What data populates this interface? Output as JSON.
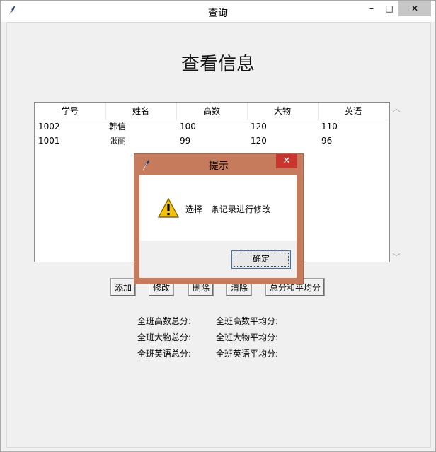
{
  "window": {
    "title": "查询",
    "controls": {
      "minimize": "–",
      "maximize": "□",
      "close": "✕"
    }
  },
  "page": {
    "heading": "查看信息"
  },
  "table": {
    "columns": [
      "学号",
      "姓名",
      "高数",
      "大物",
      "英语"
    ],
    "rows": [
      [
        "1002",
        "韩信",
        "100",
        "120",
        "110"
      ],
      [
        "1001",
        "张丽",
        "99",
        "120",
        "96"
      ]
    ]
  },
  "buttons": {
    "add": "添加",
    "modify": "修改",
    "delete": "删除",
    "clear": "清除",
    "totals": "总分和平均分"
  },
  "stats": {
    "math_total": "全班高数总分:",
    "math_avg": "全班高数平均分:",
    "physics_total": "全班大物总分:",
    "physics_avg": "全班大物平均分:",
    "english_total": "全班英语总分:",
    "english_avg": "全班英语平均分:"
  },
  "dialog": {
    "title": "提示",
    "message": "选择一条记录进行修改",
    "ok": "确定",
    "icon": "warning-icon",
    "close": "✕"
  },
  "colors": {
    "dialog_frame": "#c67c5c",
    "dialog_close": "#c7372f",
    "background": "#f0f0f0"
  }
}
